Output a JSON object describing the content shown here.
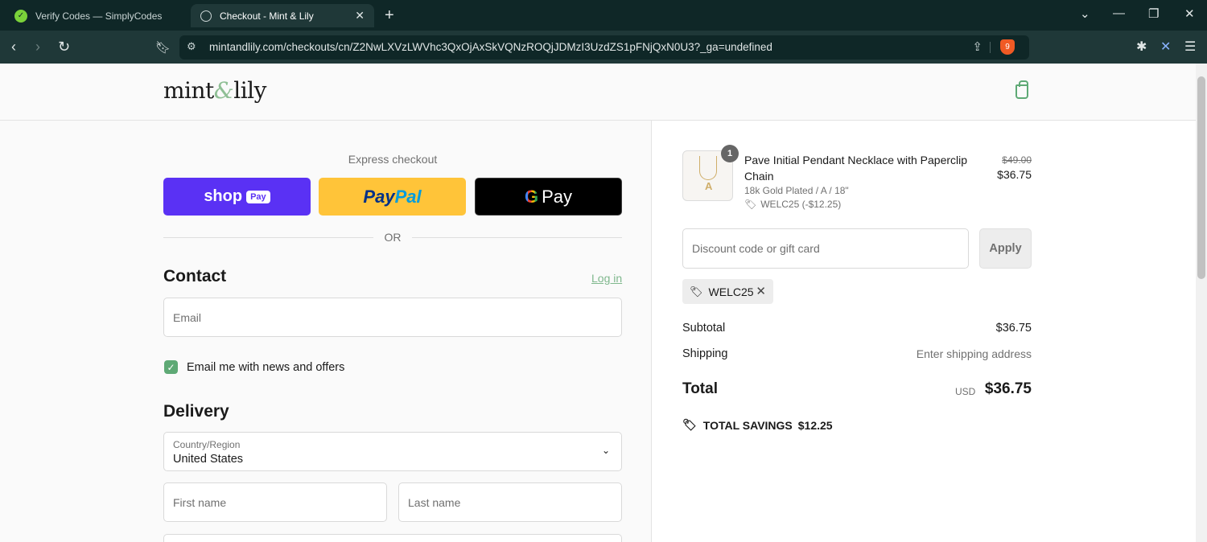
{
  "browser": {
    "tabs": [
      {
        "title": "Verify Codes — SimplyCodes",
        "icon": "simplycodes-icon"
      },
      {
        "title": "Checkout - Mint & Lily",
        "icon": "globe-icon"
      }
    ],
    "url": "mintandlily.com/checkouts/cn/Z2NwLXVzLWVhc3QxOjAxSkVQNzROQjJDMzI3UzdZS1pFNjQxN0U3?_ga=undefined",
    "brave_badge": "9"
  },
  "header": {
    "logo_left": "mint",
    "logo_amp": "&",
    "logo_right": "lily"
  },
  "express": {
    "label": "Express checkout",
    "shop_pay": {
      "text": "shop",
      "pill": "Pay"
    },
    "paypal": {
      "p1": "Pay",
      "p2": "Pal"
    },
    "gpay": {
      "g": "G",
      "text": "Pay"
    },
    "or_text": "OR"
  },
  "contact": {
    "title": "Contact",
    "login_link": "Log in",
    "email_placeholder": "Email",
    "newsletter_label": "Email me with news and offers",
    "newsletter_checked": true
  },
  "delivery": {
    "title": "Delivery",
    "country_label": "Country/Region",
    "country_value": "United States",
    "first_name_placeholder": "First name",
    "last_name_placeholder": "Last name"
  },
  "order": {
    "item": {
      "quantity": "1",
      "name": "Pave Initial Pendant Necklace with Paperclip Chain",
      "variant": "18k Gold Plated / A / 18\"",
      "discount": "WELC25 (-$12.25)",
      "old_price": "$49.00",
      "price": "$36.75"
    },
    "discount_placeholder": "Discount code or gift card",
    "apply_label": "Apply",
    "applied_code": "WELC25",
    "subtotal_label": "Subtotal",
    "subtotal_value": "$36.75",
    "shipping_label": "Shipping",
    "shipping_value": "Enter shipping address",
    "total_label": "Total",
    "total_currency": "USD",
    "total_value": "$36.75",
    "savings_label": "TOTAL SAVINGS",
    "savings_value": "$12.25"
  },
  "colors": {
    "accent": "#5ea975",
    "shop_pay": "#5a31f4",
    "paypal": "#ffc439",
    "gpay": "#000000"
  }
}
